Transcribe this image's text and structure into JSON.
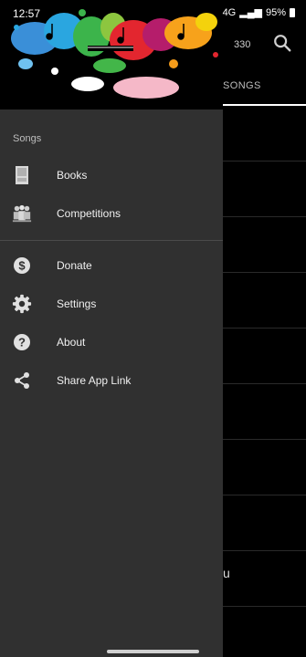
{
  "status": {
    "time": "12:57",
    "network": "4G",
    "battery": "95%"
  },
  "background": {
    "count": "330",
    "tab_label": "SONGS",
    "partial_text": "u"
  },
  "drawer": {
    "section_label": "Songs",
    "items": [
      {
        "label": "Books",
        "icon": "book-icon"
      },
      {
        "label": "Competitions",
        "icon": "competitions-icon"
      },
      {
        "label": "Donate",
        "icon": "dollar-icon"
      },
      {
        "label": "Settings",
        "icon": "gear-icon"
      },
      {
        "label": "About",
        "icon": "help-icon"
      },
      {
        "label": "Share App Link",
        "icon": "share-icon"
      }
    ]
  }
}
